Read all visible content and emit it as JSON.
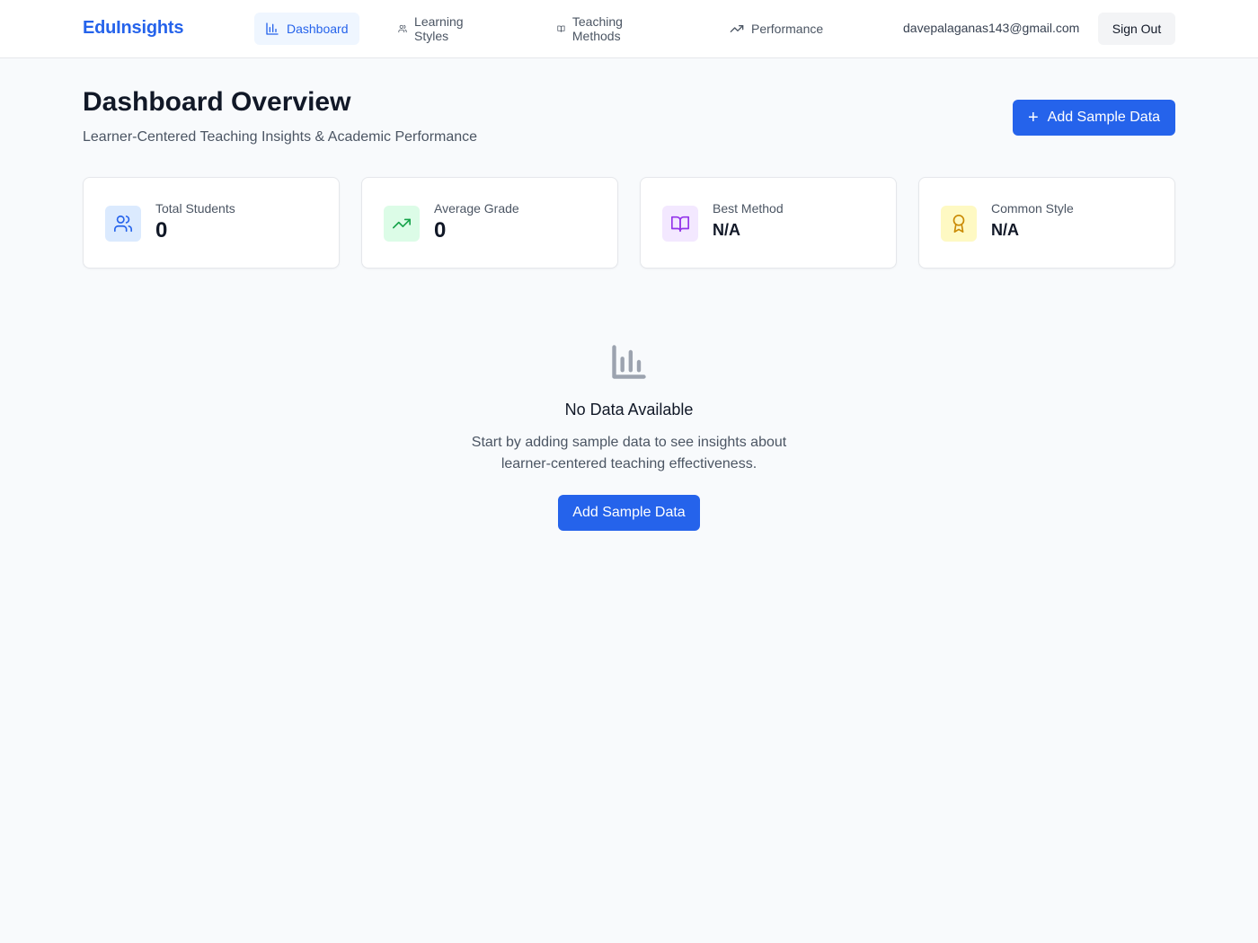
{
  "header": {
    "brand": "EduInsights",
    "nav": [
      {
        "label": "Dashboard",
        "icon": "bar-chart-icon",
        "active": true
      },
      {
        "label": "Learning Styles",
        "icon": "users-icon",
        "active": false
      },
      {
        "label": "Teaching Methods",
        "icon": "book-open-icon",
        "active": false
      },
      {
        "label": "Performance",
        "icon": "trending-up-icon",
        "active": false
      }
    ],
    "user_email": "davepalaganas143@gmail.com",
    "sign_out_label": "Sign Out"
  },
  "page": {
    "title": "Dashboard Overview",
    "subtitle": "Learner-Centered Teaching Insights & Academic Performance",
    "add_button_label": "Add Sample Data",
    "add_button_icon": "plus-icon"
  },
  "stats": [
    {
      "label": "Total Students",
      "value": "0",
      "icon": "users-icon",
      "color": "#2563eb",
      "bg": "#dbeafe"
    },
    {
      "label": "Average Grade",
      "value": "0",
      "icon": "trending-up-icon",
      "color": "#16a34a",
      "bg": "#dcfce7"
    },
    {
      "label": "Best Method",
      "value": "N/A",
      "icon": "book-open-icon",
      "color": "#9333ea",
      "bg": "#f3e8ff"
    },
    {
      "label": "Common Style",
      "value": "N/A",
      "icon": "award-icon",
      "color": "#ca8a04",
      "bg": "#fef9c3"
    }
  ],
  "empty_state": {
    "icon": "bar-chart-icon",
    "title": "No Data Available",
    "description": "Start by adding sample data to see insights about learner-centered teaching effectiveness.",
    "button_label": "Add Sample Data"
  },
  "colors": {
    "accent": "#2563eb",
    "background": "#f8fafc"
  }
}
